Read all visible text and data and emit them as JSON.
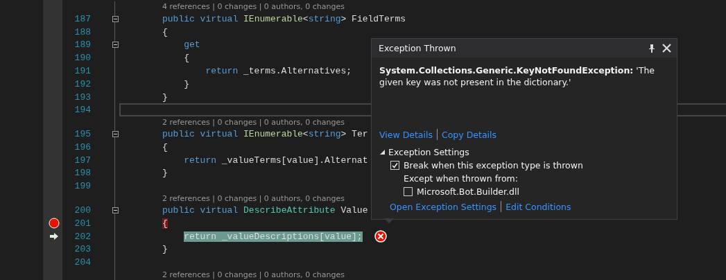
{
  "editor": {
    "rows": [
      {
        "kind": "lens",
        "text": "4 references | 0 changes | 0 authors, 0 changes"
      },
      {
        "kind": "code",
        "number": "187",
        "fold": true,
        "segments": [
          {
            "kind": "keyword",
            "text": "public virtual "
          },
          {
            "kind": "interface",
            "text": "IEnumerable"
          },
          {
            "kind": "plain",
            "text": "<"
          },
          {
            "kind": "keyword",
            "text": "string"
          },
          {
            "kind": "plain",
            "text": "> FieldTerms"
          }
        ]
      },
      {
        "kind": "code",
        "number": "188",
        "segments": [
          {
            "kind": "plain",
            "text": "{"
          }
        ],
        "children": [
          {
            "kind": "code",
            "number": "189",
            "fold": true,
            "segments": [
              {
                "kind": "keyword",
                "text": "get"
              }
            ]
          },
          {
            "kind": "code",
            "number": "190",
            "segments": [
              {
                "kind": "plain",
                "text": "{"
              }
            ],
            "children": [
              {
                "kind": "code",
                "number": "191",
                "segments": [
                  {
                    "kind": "keyword",
                    "text": "return "
                  },
                  {
                    "kind": "plain",
                    "text": "_terms.Alternatives;"
                  }
                ]
              }
            ]
          },
          {
            "kind": "code",
            "number": "192",
            "segments": [
              {
                "kind": "plain",
                "text": "}"
              }
            ]
          }
        ]
      },
      {
        "kind": "code",
        "number": "193",
        "segments": [
          {
            "kind": "plain",
            "text": "}"
          }
        ]
      },
      {
        "kind": "code",
        "number": "194",
        "caret_line": true
      },
      {
        "kind": "lens",
        "text": "2 references | 0 changes | 0 authors, 0 changes"
      },
      {
        "kind": "code",
        "number": "195",
        "fold": true,
        "segments": [
          {
            "kind": "keyword",
            "text": "public virtual "
          },
          {
            "kind": "interface",
            "text": "IEnumerable"
          },
          {
            "kind": "plain",
            "text": "<"
          },
          {
            "kind": "keyword",
            "text": "string"
          },
          {
            "kind": "plain",
            "text": "> Ter"
          }
        ]
      },
      {
        "kind": "code",
        "number": "196",
        "segments": [
          {
            "kind": "plain",
            "text": "{"
          }
        ],
        "children": [
          {
            "kind": "code",
            "number": "197",
            "segments": [
              {
                "kind": "keyword",
                "text": "return "
              },
              {
                "kind": "plain",
                "text": "_valueTerms[value].Alternat"
              }
            ]
          }
        ]
      },
      {
        "kind": "code",
        "number": "198",
        "segments": [
          {
            "kind": "plain",
            "text": "}"
          }
        ]
      },
      {
        "kind": "code",
        "number": "199"
      },
      {
        "kind": "lens",
        "text": "2 references | 0 changes | 0 authors, 0 changes"
      },
      {
        "kind": "code",
        "number": "200",
        "fold": true,
        "segments": [
          {
            "kind": "keyword",
            "text": "public virtual "
          },
          {
            "kind": "class",
            "text": "DescribeAttribute"
          },
          {
            "kind": "plain",
            "text": " Value"
          }
        ]
      },
      {
        "kind": "code",
        "number": "201",
        "breakpoint": true,
        "segments": [
          {
            "kind": "plain",
            "text": "{"
          }
        ],
        "children": [
          {
            "kind": "code",
            "number": "202",
            "current": true,
            "error": true,
            "segments": [
              {
                "kind": "plain",
                "text": "return _valueDescriptions[value];"
              }
            ]
          }
        ]
      },
      {
        "kind": "code",
        "number": "203",
        "segments": [
          {
            "kind": "plain",
            "text": "}"
          }
        ]
      },
      {
        "kind": "code",
        "number": "204"
      },
      {
        "kind": "lens",
        "text": "2 references | 0 changes | 0 authors, 0 changes"
      }
    ]
  },
  "exception_popup": {
    "title": "Exception Thrown",
    "exception_type": "System.Collections.Generic.KeyNotFoundException:",
    "message": "'The given key was not present in the dictionary.'",
    "links": [
      "View Details",
      "Copy Details"
    ],
    "settings": {
      "title": "Exception Settings",
      "expanded": true,
      "break_option": {
        "label": "Break when this exception type is thrown",
        "checked": true
      },
      "except_label": "Except when thrown from:",
      "modules": [
        {
          "label": "Microsoft.Bot.Builder.dll",
          "checked": false
        }
      ],
      "links": [
        "Open Exception Settings",
        "Edit Conditions"
      ]
    }
  }
}
